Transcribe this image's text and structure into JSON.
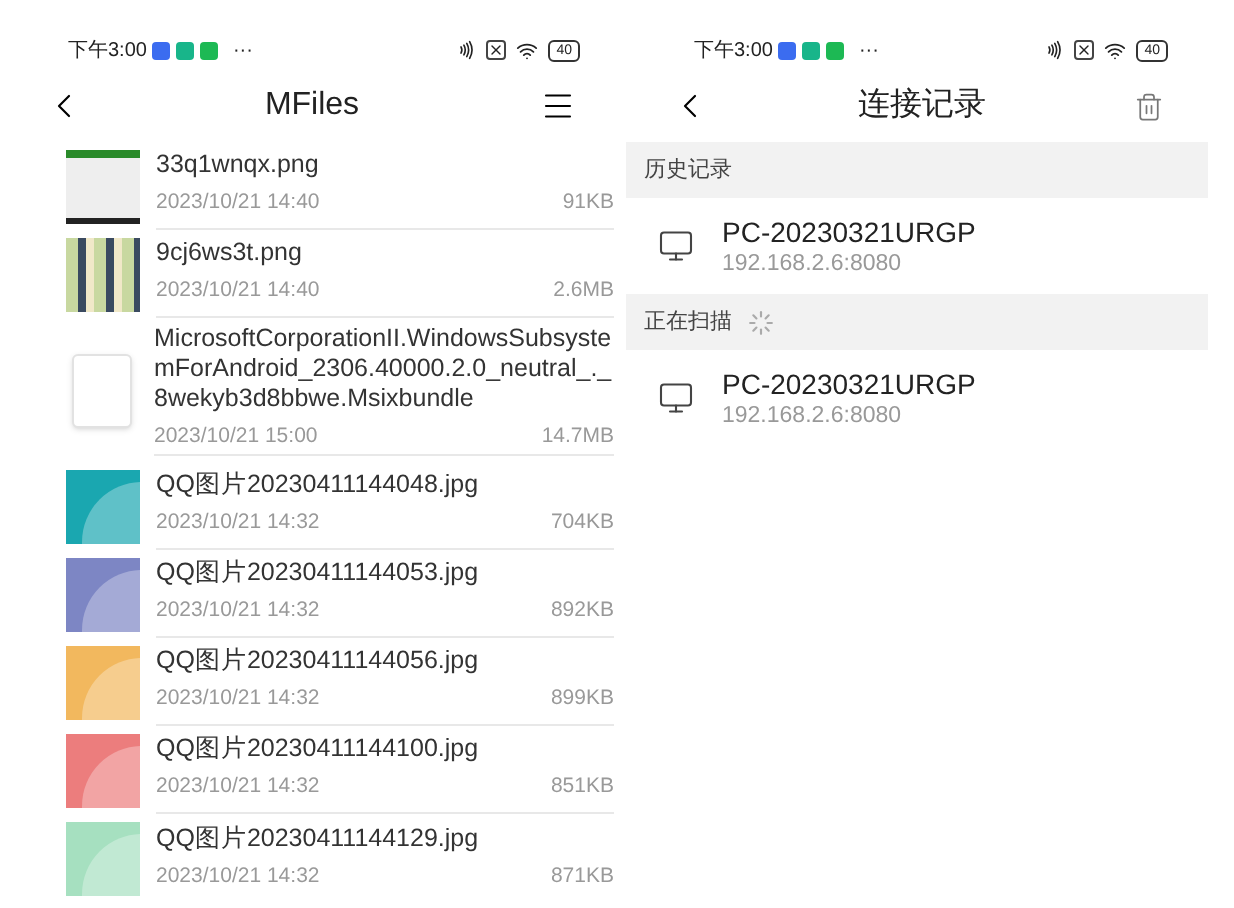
{
  "screens": [
    {
      "status_bar": {
        "time": "下午3:00",
        "more": "···",
        "battery": "40"
      },
      "nav": {
        "title": "MFiles",
        "action": {
          "kind": "menu"
        }
      },
      "files": [
        {
          "name": "33q1wnqx.png",
          "date": "2023/10/21 14:40",
          "size": "91KB",
          "kind": "screenshot"
        },
        {
          "name": "9cj6ws3t.png",
          "date": "2023/10/21 14:40",
          "size": "2.6MB",
          "kind": "collage"
        },
        {
          "name": "MicrosoftCorporationII.WindowsSubsystemForAndroid_2306.40000.2.0_neutral_._8wekyb3d8bbwe.Msixbundle",
          "date": "2023/10/21 15:00",
          "size": "14.7MB",
          "kind": "file"
        },
        {
          "name": "QQ图片20230411144048.jpg",
          "date": "2023/10/21 14:32",
          "size": "704KB",
          "kind": "image",
          "color": "#1aa7b0"
        },
        {
          "name": "QQ图片20230411144053.jpg",
          "date": "2023/10/21 14:32",
          "size": "892KB",
          "kind": "image",
          "color": "#7d86c4"
        },
        {
          "name": "QQ图片20230411144056.jpg",
          "date": "2023/10/21 14:32",
          "size": "899KB",
          "kind": "image",
          "color": "#f2b85e"
        },
        {
          "name": "QQ图片20230411144100.jpg",
          "date": "2023/10/21 14:32",
          "size": "851KB",
          "kind": "image",
          "color": "#ec7d7d"
        },
        {
          "name": "QQ图片20230411144129.jpg",
          "date": "2023/10/21 14:32",
          "size": "871KB",
          "kind": "image",
          "color": "#a6e0c0"
        }
      ]
    },
    {
      "status_bar": {
        "time": "下午3:00",
        "more": "···",
        "battery": "40"
      },
      "nav": {
        "title": "连接记录",
        "action": {
          "kind": "trash"
        }
      },
      "sections": [
        {
          "title": "历史记录",
          "scanning": false,
          "devices": [
            {
              "name": "PC-20230321URGP",
              "address": "192.168.2.6:8080"
            }
          ]
        },
        {
          "title": "正在扫描",
          "scanning": true,
          "devices": [
            {
              "name": "PC-20230321URGP",
              "address": "192.168.2.6:8080"
            }
          ]
        }
      ]
    }
  ]
}
